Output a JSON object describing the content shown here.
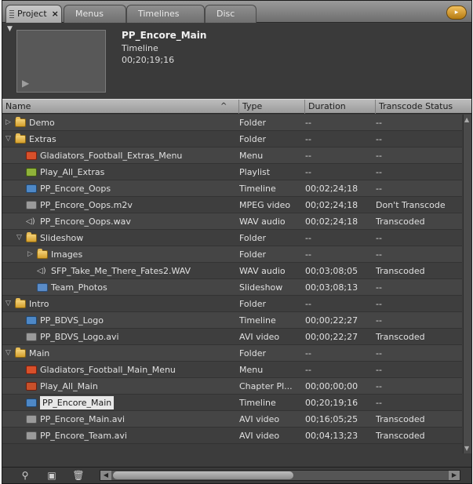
{
  "tabs": [
    {
      "label": "Project",
      "close": "×",
      "active": true
    },
    {
      "label": "Menus",
      "active": false
    },
    {
      "label": "Timelines",
      "active": false
    },
    {
      "label": "Disc",
      "active": false
    }
  ],
  "preview": {
    "title": "PP_Encore_Main",
    "type": "Timeline",
    "duration": "00;20;19;16"
  },
  "columns": {
    "name": "Name",
    "type": "Type",
    "duration": "Duration",
    "status": "Transcode Status"
  },
  "rows": [
    {
      "name": "Demo",
      "icon": "folder",
      "type": "Folder",
      "duration": "--",
      "status": "--"
    },
    {
      "name": "Extras",
      "icon": "folder",
      "type": "Folder",
      "duration": "--",
      "status": "--"
    },
    {
      "name": "Gladiators_Football_Extras_Menu",
      "icon": "menu",
      "type": "Menu",
      "duration": "--",
      "status": "--"
    },
    {
      "name": "Play_All_Extras",
      "icon": "playlist",
      "type": "Playlist",
      "duration": "--",
      "status": "--"
    },
    {
      "name": "PP_Encore_Oops",
      "icon": "timeline",
      "type": "Timeline",
      "duration": "00;02;24;18",
      "status": "--"
    },
    {
      "name": "PP_Encore_Oops.m2v",
      "icon": "video",
      "type": "MPEG video",
      "duration": "00;02;24;18",
      "status": "Don't Transcode"
    },
    {
      "name": "PP_Encore_Oops.wav",
      "icon": "audio",
      "type": "WAV audio",
      "duration": "00;02;24;18",
      "status": "Transcoded"
    },
    {
      "name": "Slideshow",
      "icon": "folder",
      "type": "Folder",
      "duration": "--",
      "status": "--"
    },
    {
      "name": "Images",
      "icon": "folder",
      "type": "Folder",
      "duration": "--",
      "status": "--"
    },
    {
      "name": "SFP_Take_Me_There_Fates2.WAV",
      "icon": "audio",
      "type": "WAV audio",
      "duration": "00;03;08;05",
      "status": "Transcoded"
    },
    {
      "name": "Team_Photos",
      "icon": "slideshow",
      "type": "Slideshow",
      "duration": "00;03;08;13",
      "status": "--"
    },
    {
      "name": "Intro",
      "icon": "folder",
      "type": "Folder",
      "duration": "--",
      "status": "--"
    },
    {
      "name": "PP_BDVS_Logo",
      "icon": "timeline",
      "type": "Timeline",
      "duration": "00;00;22;27",
      "status": "--"
    },
    {
      "name": "PP_BDVS_Logo.avi",
      "icon": "video",
      "type": "AVI video",
      "duration": "00;00;22;27",
      "status": "Transcoded"
    },
    {
      "name": "Main",
      "icon": "folder",
      "type": "Folder",
      "duration": "--",
      "status": "--"
    },
    {
      "name": "Gladiators_Football_Main_Menu",
      "icon": "menu",
      "type": "Menu",
      "duration": "--",
      "status": "--"
    },
    {
      "name": "Play_All_Main",
      "icon": "chapter",
      "type": "Chapter Pl...",
      "duration": "00;00;00;00",
      "status": "--"
    },
    {
      "name": "PP_Encore_Main",
      "icon": "timeline",
      "type": "Timeline",
      "duration": "00;20;19;16",
      "status": "--",
      "selected": true
    },
    {
      "name": "PP_Encore_Main.avi",
      "icon": "video",
      "type": "AVI video",
      "duration": "00;16;05;25",
      "status": "Transcoded"
    },
    {
      "name": "PP_Encore_Team.avi",
      "icon": "video",
      "type": "AVI video",
      "duration": "00;04;13;23",
      "status": "Transcoded"
    }
  ]
}
